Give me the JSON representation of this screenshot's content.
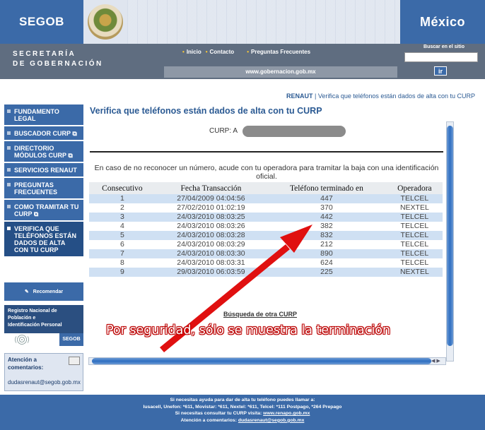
{
  "header": {
    "segob": "SEGOB",
    "mexico": "México",
    "secretaria_line1": "SECRETARÍA",
    "secretaria_line2": "DE GOBERNACIÓN",
    "nav": [
      "Inicio",
      "Contacto",
      "Preguntas Frecuentes"
    ],
    "url": "www.gobernacion.gob.mx",
    "search_label": "Buscar en el sitio",
    "search_value": "",
    "search_button": "ir"
  },
  "sidebar": {
    "items": [
      {
        "label": "FUNDAMENTO LEGAL",
        "ext": false
      },
      {
        "label": "BUSCADOR CURP",
        "ext": true
      },
      {
        "label": "DIRECTORIO MÓDULOS CURP",
        "ext": true
      },
      {
        "label": "SERVICIOS RENAUT",
        "ext": false
      },
      {
        "label": "PREGUNTAS FRECUENTES",
        "ext": false
      },
      {
        "label": "COMO TRAMITAR TU CURP",
        "ext": true
      },
      {
        "label": "VERIFICA QUE TELÉFONOS ESTÁN DADOS DE ALTA CON TU CURP",
        "ext": false
      }
    ],
    "recomendar": "Recomendar",
    "renapo_line1": "Registro Nacional de",
    "renapo_line2": "Población e",
    "renapo_line3": "Identificación Personal",
    "renapo_segob": "SEGOB",
    "atencion_line1": "Atención a",
    "atencion_line2": "comentarios:",
    "email": "dudasrenaut@segob.gob.mx"
  },
  "main": {
    "breadcrumb_link": "RENAUT",
    "breadcrumb_sep": "|",
    "breadcrumb_current": "Verifica que teléfonos están dados de alta con tu CURP",
    "title": "Verifica que teléfonos están dados de alta con tu CURP",
    "curp_label": "CURP: A",
    "note": "En caso de no reconocer un número, acude con tu operadora para tramitar la baja con una identificación oficial.",
    "columns": [
      "Consecutivo",
      "Fecha Transacción",
      "Teléfono terminado en",
      "Operadora"
    ],
    "rows": [
      [
        "1",
        "27/04/2009 04:04:56",
        "447",
        "TELCEL"
      ],
      [
        "2",
        "27/02/2010 01:02:19",
        "370",
        "NEXTEL"
      ],
      [
        "3",
        "24/03/2010 08:03:25",
        "442",
        "TELCEL"
      ],
      [
        "4",
        "24/03/2010 08:03:26",
        "382",
        "TELCEL"
      ],
      [
        "5",
        "24/03/2010 08:03:28",
        "832",
        "TELCEL"
      ],
      [
        "6",
        "24/03/2010 08:03:29",
        "212",
        "TELCEL"
      ],
      [
        "7",
        "24/03/2010 08:03:30",
        "890",
        "TELCEL"
      ],
      [
        "8",
        "24/03/2010 08:03:31",
        "624",
        "TELCEL"
      ],
      [
        "9",
        "29/03/2010 06:03:59",
        "225",
        "NEXTEL"
      ]
    ],
    "otra_link": "Búsqueda de otra CURP",
    "callout": "Por seguridad, sólo se muestra la terminación"
  },
  "footer": {
    "line1": "Si necesitas ayuda para dar de alta tu teléfono puedes llamar a:",
    "line2": "Iusacell, Unefon: *611, Movistar: *611, Nextel: *611, Telcel: *111 Postpago, *264 Prepago",
    "line3_prefix": "Si necesitas consultar tu CURP visita:",
    "line3_link": "www.renapo.gob.mx",
    "line4_prefix": "Atención a comentarios:",
    "line4_link": "dudasrenaut@segob.gob.mx"
  },
  "colors": {
    "brand_blue": "#3b6aa8",
    "header_gray": "#5f6d80",
    "row_alt": "#cfe0f3",
    "arrow_red": "#e01010"
  }
}
